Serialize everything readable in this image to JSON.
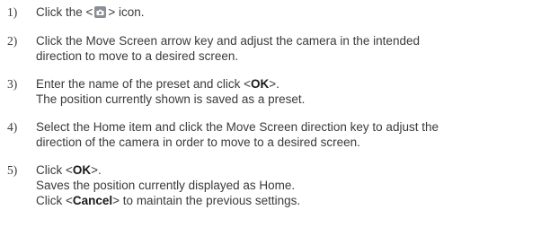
{
  "steps": [
    {
      "number": "1)",
      "pre_icon": "Click the <",
      "icon": "camera-settings-icon",
      "post_icon": "> icon."
    },
    {
      "number": "2)",
      "lines": [
        "Click the Move Screen arrow key and adjust the camera in the intended",
        "direction to move to a desired screen."
      ]
    },
    {
      "number": "3)",
      "line1_pre": "Enter the name of the preset and click <",
      "line1_bold": "OK",
      "line1_post": ">.",
      "line2": "The position currently shown is saved as a preset."
    },
    {
      "number": "4)",
      "lines": [
        "Select the Home item and click the Move Screen direction key to adjust the",
        "direction of the camera in order to move to a desired screen."
      ]
    },
    {
      "number": "5)",
      "line1_pre": "Click <",
      "line1_bold": "OK",
      "line1_post": ">.",
      "line2": "Saves the position currently displayed as Home.",
      "line3_pre": "Click <",
      "line3_bold": "Cancel",
      "line3_post": "> to maintain the previous settings."
    }
  ],
  "colors": {
    "text": "#3a3a3a",
    "bold_text": "#1a1a1a",
    "icon_bg": "#8a8f95",
    "icon_fg": "#ffffff"
  }
}
